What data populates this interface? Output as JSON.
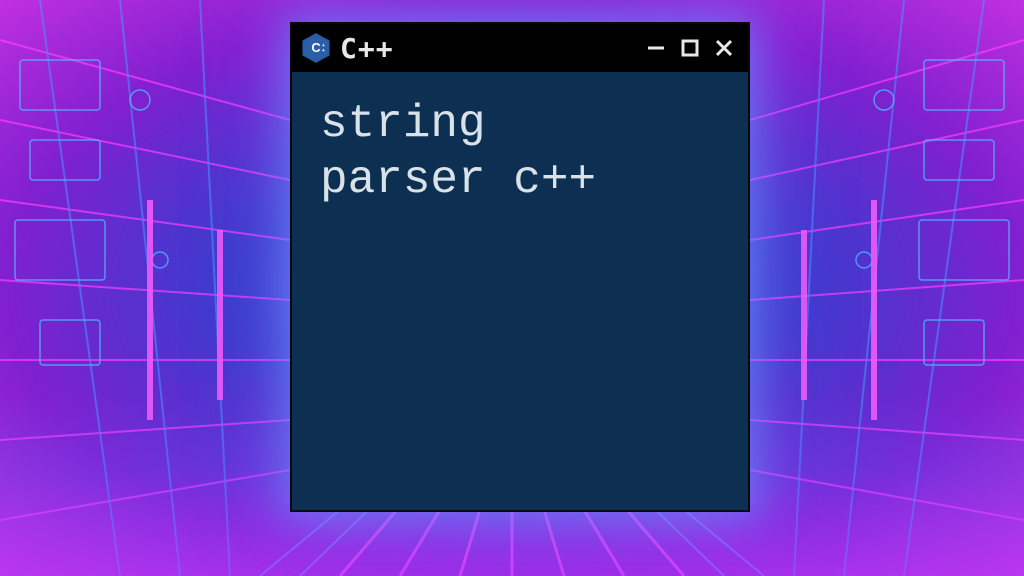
{
  "window": {
    "title": "C++",
    "icon_name": "cpp-hexagon-icon"
  },
  "content": {
    "line1": "string",
    "line2": "parser c++"
  },
  "colors": {
    "bg_deep": "#0d2f52",
    "titlebar": "#000000",
    "text": "#d8e2e8",
    "accent_blue": "#3a6fff",
    "accent_magenta": "#e040ff",
    "cpp_blue": "#2a5fa8"
  }
}
